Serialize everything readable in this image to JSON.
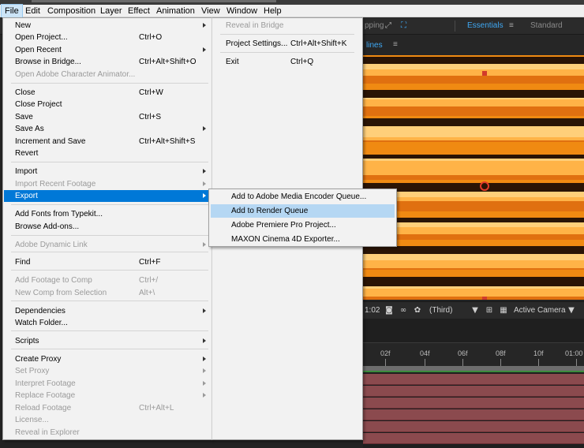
{
  "menubar": {
    "items": [
      "File",
      "Edit",
      "Composition",
      "Layer",
      "Effect",
      "Animation",
      "View",
      "Window",
      "Help"
    ]
  },
  "toolbar": {
    "snapping": "pping",
    "essentials": "Essentials",
    "standard": "Standard",
    "guides": "lines"
  },
  "file_menu": {
    "items": [
      {
        "label": "New",
        "shortcut": "",
        "submenu": true,
        "enabled": true
      },
      {
        "label": "Open Project...",
        "shortcut": "Ctrl+O",
        "submenu": false,
        "enabled": true
      },
      {
        "label": "Open Recent",
        "shortcut": "",
        "submenu": true,
        "enabled": true
      },
      {
        "label": "Browse in Bridge...",
        "shortcut": "Ctrl+Alt+Shift+O",
        "submenu": false,
        "enabled": true
      },
      {
        "label": "Open Adobe Character Animator...",
        "shortcut": "",
        "submenu": false,
        "enabled": false
      },
      {
        "label": "Close",
        "shortcut": "Ctrl+W",
        "submenu": false,
        "enabled": true
      },
      {
        "label": "Close Project",
        "shortcut": "",
        "submenu": false,
        "enabled": true
      },
      {
        "label": "Save",
        "shortcut": "Ctrl+S",
        "submenu": false,
        "enabled": true
      },
      {
        "label": "Save As",
        "shortcut": "",
        "submenu": true,
        "enabled": true
      },
      {
        "label": "Increment and Save",
        "shortcut": "Ctrl+Alt+Shift+S",
        "submenu": false,
        "enabled": true
      },
      {
        "label": "Revert",
        "shortcut": "",
        "submenu": false,
        "enabled": true
      },
      {
        "label": "Import",
        "shortcut": "",
        "submenu": true,
        "enabled": true
      },
      {
        "label": "Import Recent Footage",
        "shortcut": "",
        "submenu": true,
        "enabled": false
      },
      {
        "label": "Export",
        "shortcut": "",
        "submenu": true,
        "enabled": true
      },
      {
        "label": "Add Fonts from Typekit...",
        "shortcut": "",
        "submenu": false,
        "enabled": true
      },
      {
        "label": "Browse Add-ons...",
        "shortcut": "",
        "submenu": false,
        "enabled": true
      },
      {
        "label": "Adobe Dynamic Link",
        "shortcut": "",
        "submenu": true,
        "enabled": false
      },
      {
        "label": "Find",
        "shortcut": "Ctrl+F",
        "submenu": false,
        "enabled": true
      },
      {
        "label": "Add Footage to Comp",
        "shortcut": "Ctrl+/",
        "submenu": false,
        "enabled": false
      },
      {
        "label": "New Comp from Selection",
        "shortcut": "Alt+\\",
        "submenu": false,
        "enabled": false
      },
      {
        "label": "Dependencies",
        "shortcut": "",
        "submenu": true,
        "enabled": true
      },
      {
        "label": "Watch Folder...",
        "shortcut": "",
        "submenu": false,
        "enabled": true
      },
      {
        "label": "Scripts",
        "shortcut": "",
        "submenu": true,
        "enabled": true
      },
      {
        "label": "Create Proxy",
        "shortcut": "",
        "submenu": true,
        "enabled": true
      },
      {
        "label": "Set Proxy",
        "shortcut": "",
        "submenu": true,
        "enabled": false
      },
      {
        "label": "Interpret Footage",
        "shortcut": "",
        "submenu": true,
        "enabled": false
      },
      {
        "label": "Replace Footage",
        "shortcut": "",
        "submenu": true,
        "enabled": false
      },
      {
        "label": "Reload Footage",
        "shortcut": "Ctrl+Alt+L",
        "submenu": false,
        "enabled": false
      },
      {
        "label": "License...",
        "shortcut": "",
        "submenu": false,
        "enabled": false
      },
      {
        "label": "Reveal in Explorer",
        "shortcut": "",
        "submenu": false,
        "enabled": false
      }
    ],
    "right_column": [
      {
        "label": "Reveal in Bridge",
        "shortcut": "",
        "enabled": false
      },
      {
        "label": "Project Settings...",
        "shortcut": "Ctrl+Alt+Shift+K",
        "enabled": true
      },
      {
        "label": "Exit",
        "shortcut": "Ctrl+Q",
        "enabled": true
      }
    ]
  },
  "export_submenu": {
    "items": [
      {
        "label": "Add to Adobe Media Encoder Queue...",
        "selected": false
      },
      {
        "label": "Add to Render Queue",
        "selected": true
      },
      {
        "label": "Adobe Premiere Pro Project...",
        "selected": false
      },
      {
        "label": "MAXON Cinema 4D Exporter...",
        "selected": false
      }
    ]
  },
  "viewer": {
    "timecode": "1:02",
    "view": "(Third)",
    "camera": "Active Camera"
  },
  "timeline": {
    "ruler": [
      "02f",
      "04f",
      "06f",
      "08f",
      "10f",
      "01:00"
    ]
  },
  "colors": {
    "highlight": "#0078d7",
    "submenu_selected": "#b5d7f3",
    "accent": "#3fa9f5",
    "footage_orange": "#e07a10"
  }
}
